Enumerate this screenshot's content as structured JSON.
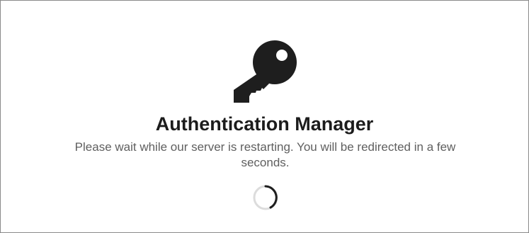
{
  "auth_page": {
    "icon": "key-icon",
    "title": "Authentication Manager",
    "message": "Please wait while our server is restarting. You will be redirected in a few seconds.",
    "spinner": "loading-spinner",
    "colors": {
      "icon": "#1e1e1e",
      "title": "#1c1c1c",
      "message": "#5f5f5f",
      "spinner_track": "#dcdcdc",
      "spinner_arc": "#1e1e1e",
      "border": "#8a8a8a"
    }
  }
}
